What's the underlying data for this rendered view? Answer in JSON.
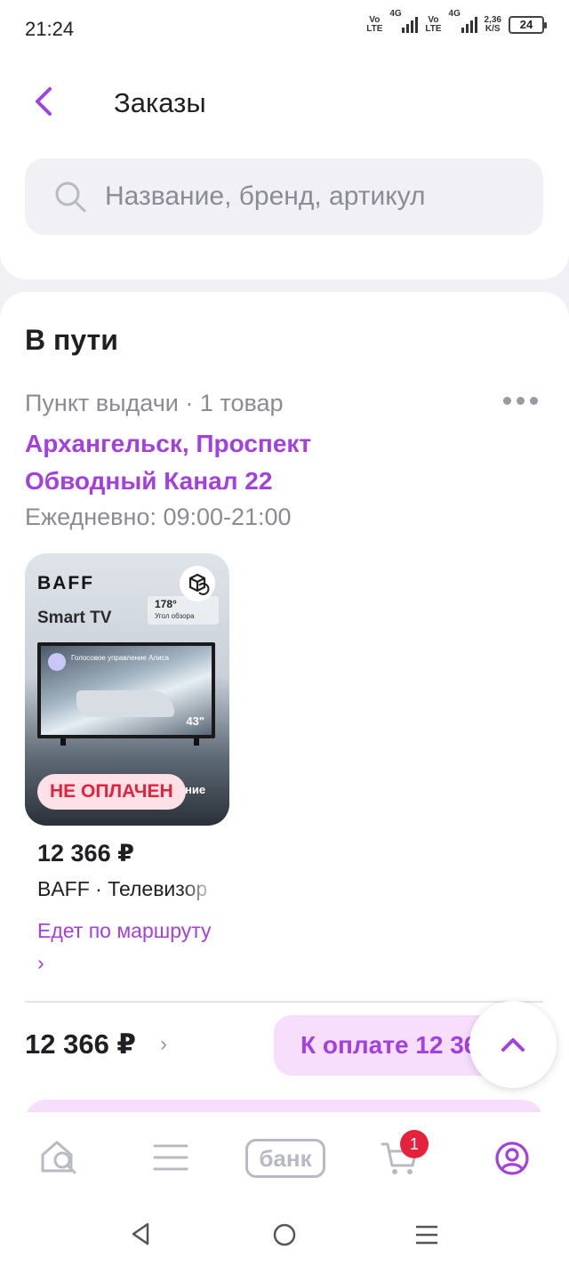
{
  "status_bar": {
    "time": "21:24",
    "sim1": "Vo\nLTE",
    "net1": "4G",
    "sim2": "Vo\nLTE",
    "net2": "4G",
    "speed": "2,36\nK/S",
    "battery": "24"
  },
  "header": {
    "title": "Заказы",
    "back_icon": "chevron-left-icon"
  },
  "search": {
    "placeholder": "Название, бренд, артикул",
    "icon": "search-icon"
  },
  "section": {
    "title": "В пути",
    "pickup_meta": "Пункт выдачи · 1 товар",
    "address": "Архангельск, Проспект Обводный Канал 22",
    "hours": "Ежедневно: 09:00-21:00"
  },
  "product": {
    "image_brand": "BAFF",
    "image_smart": "Smart TV",
    "image_angle_num": "178°",
    "image_angle_txt": "Угол обзора",
    "image_alice": "Голосовое управление Алиса",
    "image_size": "43\"",
    "image_hidden_txt": "ние",
    "badge": "НЕ ОПЛАЧЕН",
    "price": "12 366 ₽",
    "name": "BAFF · Телевизор",
    "status_link": "Едет по маршруту ›"
  },
  "footer": {
    "total": "12 366 ₽",
    "total_chevron": "›",
    "pay_button": "К оплате 12 366 ₽"
  },
  "bottom_nav": {
    "bank_label": "банк",
    "cart_count": "1"
  },
  "colors": {
    "accent": "#a340e0",
    "badge_red": "#e5223d",
    "accent_light": "#f6defc"
  }
}
